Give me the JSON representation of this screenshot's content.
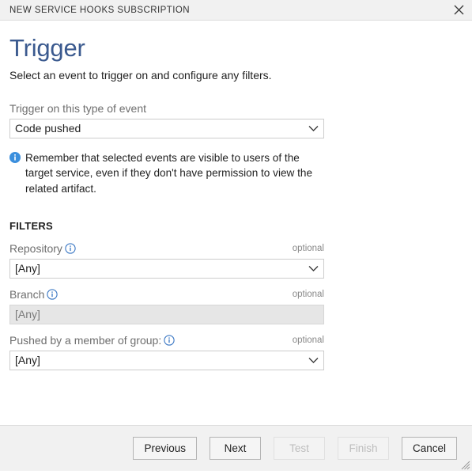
{
  "window": {
    "title": "NEW SERVICE HOOKS SUBSCRIPTION",
    "close_icon": "close-icon",
    "resize_grip": "resize-grip"
  },
  "page": {
    "title": "Trigger",
    "subtitle": "Select an event to trigger on and configure any filters.",
    "title_color": "#3b5a8f"
  },
  "event": {
    "label": "Trigger on this type of event",
    "value": "Code pushed",
    "options": [
      "Code pushed"
    ],
    "chevron_icon": "chevron-down-icon"
  },
  "note": {
    "icon": "info-circle-filled-icon",
    "text": "Remember that selected events are visible to users of the target service, even if they don't have permission to view the related artifact.",
    "icon_color": "#0078d4"
  },
  "filters": {
    "heading": "FILTERS",
    "optional_tag": "optional",
    "info_icon": "info-circle-outline-icon",
    "fields": [
      {
        "label": "Repository",
        "value": "[Any]",
        "optional": "optional",
        "disabled": false
      },
      {
        "label": "Branch",
        "value": "[Any]",
        "optional": "optional",
        "disabled": true
      },
      {
        "label": "Pushed by a member of group:",
        "value": "[Any]",
        "optional": "optional",
        "disabled": false
      }
    ]
  },
  "footer": {
    "buttons": [
      {
        "label": "Previous",
        "disabled": false
      },
      {
        "label": "Next",
        "disabled": false
      },
      {
        "label": "Test",
        "disabled": true
      },
      {
        "label": "Finish",
        "disabled": true
      },
      {
        "label": "Cancel",
        "disabled": false
      }
    ]
  }
}
